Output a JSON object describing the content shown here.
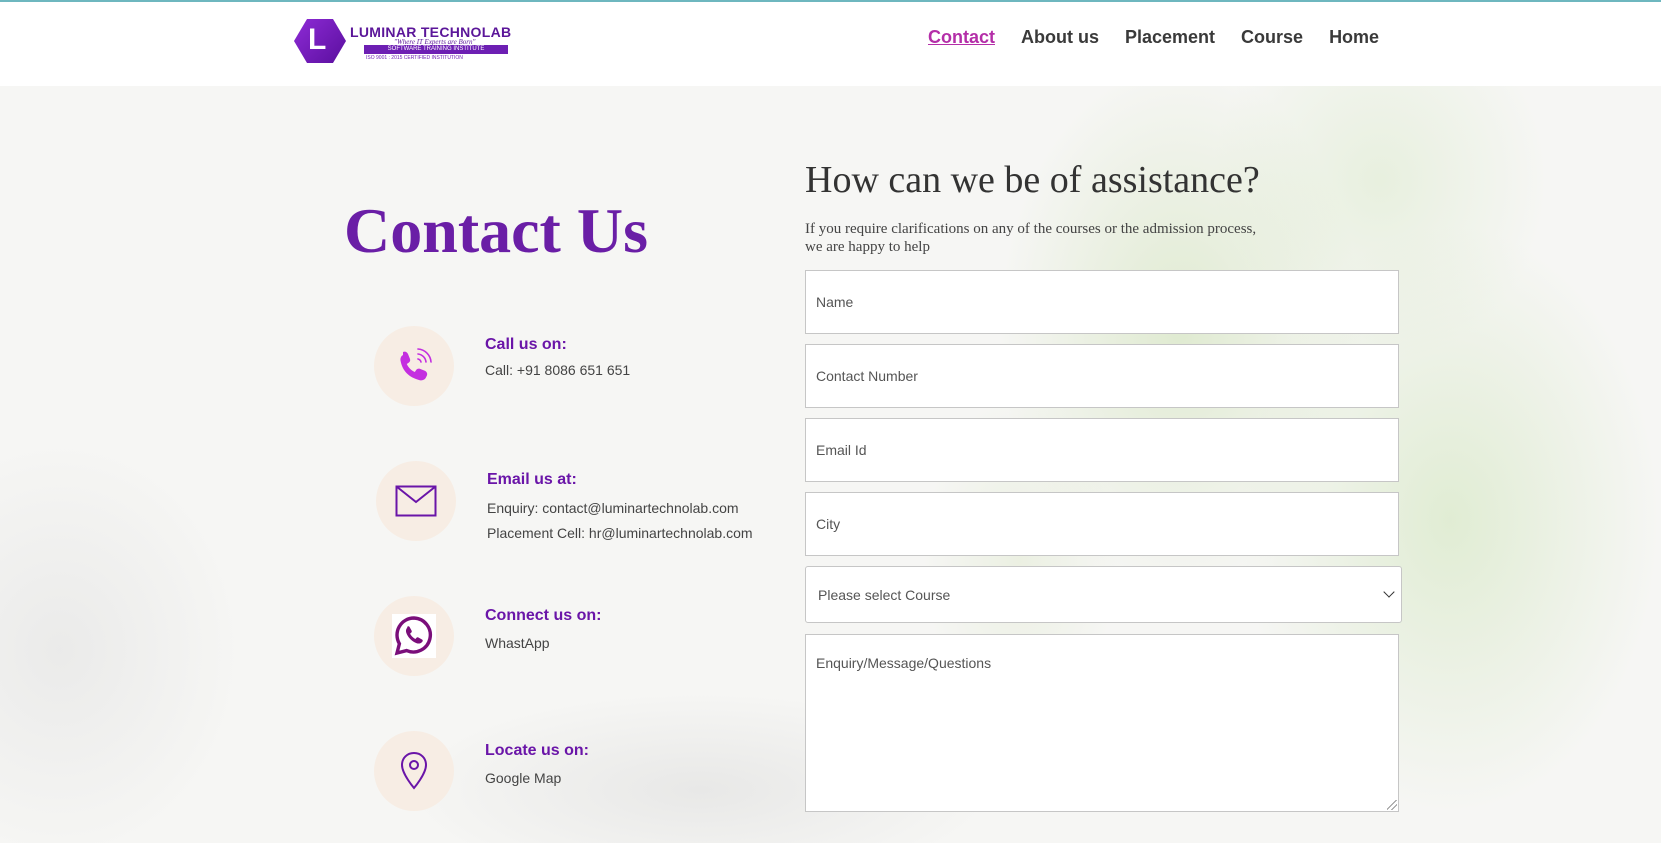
{
  "header": {
    "logo": {
      "letter": "L",
      "brand": "LUMINAR TECHNOLAB",
      "tagline": "\"Where IT Experts are Born\"",
      "institute": "SOFTWARE TRAINING INSTITUTE",
      "cert": "ISO 9001 : 2015 CERTIFIED INSTITUTION"
    },
    "nav": [
      {
        "label": "Contact",
        "active": true
      },
      {
        "label": "About us",
        "active": false
      },
      {
        "label": "Placement",
        "active": false
      },
      {
        "label": "Course",
        "active": false
      },
      {
        "label": "Home",
        "active": false
      }
    ]
  },
  "contact": {
    "title": "Contact Us",
    "items": [
      {
        "icon": "phone-icon",
        "heading": "Call us on:",
        "lines": [
          "Call: +91 8086 651 651"
        ]
      },
      {
        "icon": "envelope-icon",
        "heading": "Email us at:",
        "lines": [
          "Enquiry: contact@luminartechnolab.com",
          "Placement Cell: hr@luminartechnolab.com"
        ]
      },
      {
        "icon": "whatsapp-icon",
        "heading": "Connect us on:",
        "lines": [
          "WhastApp"
        ]
      },
      {
        "icon": "location-pin-icon",
        "heading": "Locate us on:",
        "lines": [
          "Google Map"
        ]
      }
    ]
  },
  "form": {
    "title": "How can we be of assistance?",
    "subtitle_line1": "If you require clarifications on any of the courses or the admission process,",
    "subtitle_line2": "we are happy to help",
    "name_placeholder": "Name",
    "contact_placeholder": "Contact Number",
    "email_placeholder": "Email Id",
    "city_placeholder": "City",
    "course_selected": "Please select Course",
    "message_placeholder": "Enquiry/Message/Questions"
  },
  "colors": {
    "brand_purple": "#6a1ea6",
    "nav_active": "#b42ea8",
    "icon_bg": "#f7ede4",
    "top_line": "#6eb7bf"
  }
}
